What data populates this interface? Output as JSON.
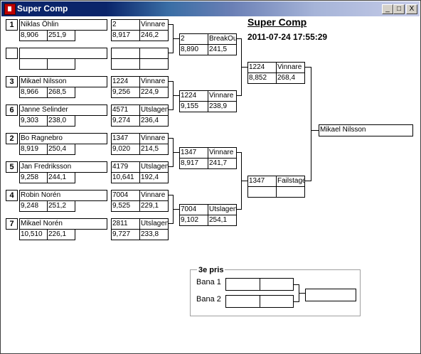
{
  "window": {
    "title": "Super Comp",
    "minimize": "_",
    "maximize": "□",
    "close": "X"
  },
  "header": {
    "heading": "Super Comp",
    "datetime": "2011-07-24 17:55:29"
  },
  "round1": [
    {
      "seed": "1",
      "name": "Niklas Öhlin",
      "rt": "8,906",
      "speed": "251,9"
    },
    {
      "seed": "",
      "name": "",
      "rt": "",
      "speed": ""
    },
    {
      "seed": "3",
      "name": "Mikael Nilsson",
      "rt": "8,966",
      "speed": "268,5"
    },
    {
      "seed": "6",
      "name": "Janne Selinder",
      "rt": "9,303",
      "speed": "238,0"
    },
    {
      "seed": "2",
      "name": "Bo Ragnebro",
      "rt": "8,919",
      "speed": "250,4"
    },
    {
      "seed": "5",
      "name": "Jan Fredriksson",
      "rt": "9,258",
      "speed": "244,1"
    },
    {
      "seed": "4",
      "name": "Robin Norén",
      "rt": "9,248",
      "speed": "251,2"
    },
    {
      "seed": "7",
      "name": "Mikael Norén",
      "rt": "10,510",
      "speed": "226,1"
    }
  ],
  "round2": [
    {
      "num": "2",
      "result": "Vinnare",
      "et": "8,917",
      "speed": "246,2"
    },
    {
      "num": "",
      "result": "",
      "et": "",
      "speed": ""
    },
    {
      "num": "1224",
      "result": "Vinnare",
      "et": "9,256",
      "speed": "224,9"
    },
    {
      "num": "4571",
      "result": "Utslagen",
      "et": "9,274",
      "speed": "236,4"
    },
    {
      "num": "1347",
      "result": "Vinnare",
      "et": "9,020",
      "speed": "214,5"
    },
    {
      "num": "4179",
      "result": "Utslagen",
      "et": "10,641",
      "speed": "192,4"
    },
    {
      "num": "7004",
      "result": "Vinnare",
      "et": "9,525",
      "speed": "229,1"
    },
    {
      "num": "2811",
      "result": "Utslagen",
      "et": "9,727",
      "speed": "233,8"
    }
  ],
  "round3": [
    {
      "num": "2",
      "result": "BreakOu",
      "et": "8,890",
      "speed": "241,5"
    },
    {
      "num": "1224",
      "result": "Vinnare",
      "et": "9,155",
      "speed": "238,9"
    },
    {
      "num": "1347",
      "result": "Vinnare",
      "et": "8,917",
      "speed": "241,7"
    },
    {
      "num": "7004",
      "result": "Utslagen",
      "et": "9,102",
      "speed": "254,1"
    }
  ],
  "semis": [
    {
      "num": "1224",
      "result": "Vinnare",
      "et": "8,852",
      "speed": "268,4"
    },
    {
      "num": "1347",
      "result": "Failstage",
      "et": "",
      "speed": ""
    }
  ],
  "final": {
    "winner": "Mikael Nilsson"
  },
  "third_place": {
    "title": "3e pris",
    "lane1_label": "Bana 1",
    "lane2_label": "Bana 2",
    "winner": ""
  }
}
